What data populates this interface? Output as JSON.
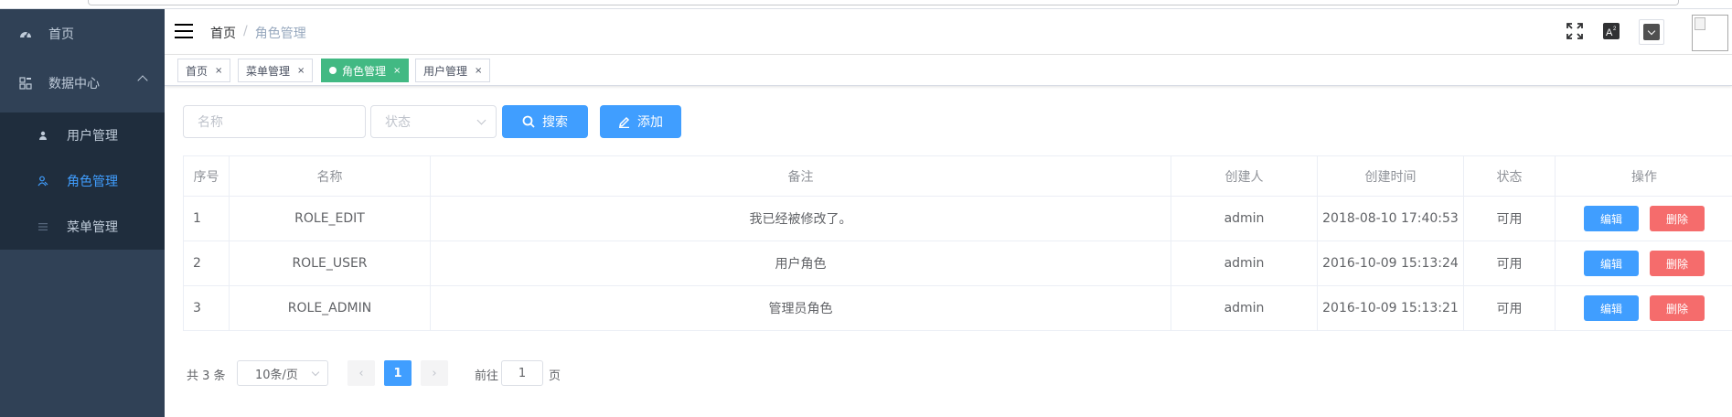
{
  "sidebar": {
    "items": [
      {
        "label": "首页",
        "icon": "dashboard-icon"
      },
      {
        "label": "数据中心",
        "icon": "data-center-icon"
      }
    ],
    "sub_items": [
      {
        "label": "用户管理",
        "icon": "user-icon"
      },
      {
        "label": "角色管理",
        "icon": "role-icon",
        "active": true
      },
      {
        "label": "菜单管理",
        "icon": "menu-list-icon"
      }
    ]
  },
  "header": {
    "breadcrumb": [
      "首页",
      "/",
      "角色管理"
    ]
  },
  "tags": [
    {
      "label": "首页",
      "close": "×"
    },
    {
      "label": "菜单管理",
      "close": "×"
    },
    {
      "label": "角色管理",
      "close": "×",
      "active": true
    },
    {
      "label": "用户管理",
      "close": "×"
    }
  ],
  "filters": {
    "name_placeholder": "名称",
    "status_placeholder": "状态",
    "search_label": "搜索",
    "add_label": "添加"
  },
  "table": {
    "headers": [
      "序号",
      "名称",
      "备注",
      "创建人",
      "创建时间",
      "状态",
      "操作"
    ],
    "rows": [
      {
        "index": "1",
        "name": "ROLE_EDIT",
        "remark": "我已经被修改了。",
        "creator": "admin",
        "created": "2018-08-10 17:40:53",
        "status": "可用",
        "edit": "编辑",
        "delete": "删除"
      },
      {
        "index": "2",
        "name": "ROLE_USER",
        "remark": "用户角色",
        "creator": "admin",
        "created": "2016-10-09 15:13:24",
        "status": "可用",
        "edit": "编辑",
        "delete": "删除"
      },
      {
        "index": "3",
        "name": "ROLE_ADMIN",
        "remark": "管理员角色",
        "creator": "admin",
        "created": "2016-10-09 15:13:21",
        "status": "可用",
        "edit": "编辑",
        "delete": "删除"
      }
    ]
  },
  "pagination": {
    "total": "共 3 条",
    "page_size": "10条/页",
    "prev": "‹",
    "current": "1",
    "next": "›",
    "goto_label": "前往",
    "goto_value": "1",
    "page_label": "页"
  },
  "colors": {
    "sidebar_bg": "#304156",
    "submenu_bg": "#1f2d3d",
    "accent": "#409eff",
    "active_tag": "#42b983",
    "danger": "#f56c6c"
  }
}
